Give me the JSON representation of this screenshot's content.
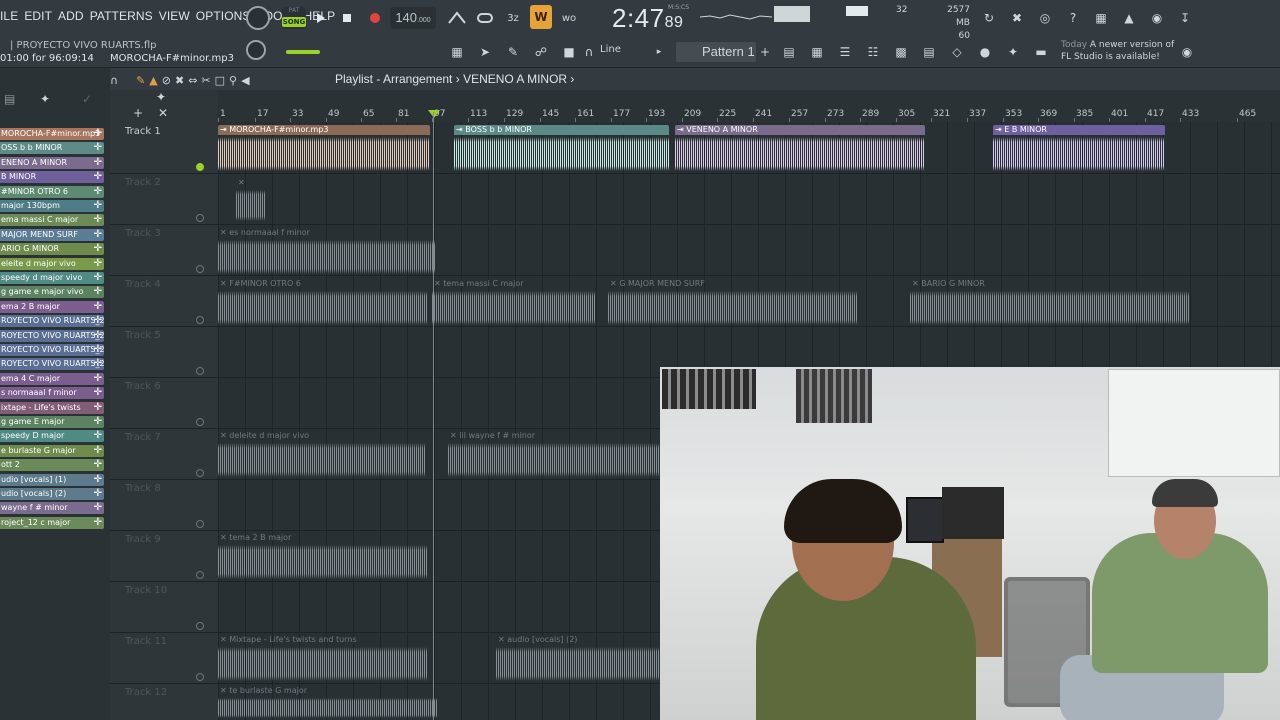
{
  "menu": [
    "ILE",
    "EDIT",
    "ADD",
    "PATTERNS",
    "VIEW",
    "OPTIONS",
    "TOOLS",
    "HELP"
  ],
  "project": {
    "name": "| PROYECTO VIVO RUARTS.flp",
    "time_info": "01:00 for 96:09:14",
    "current_file": "MOROCHA-F#minor.mp3"
  },
  "transport": {
    "mode_pat": "PAT",
    "mode_song": "SONG",
    "tempo": "140",
    "tempo_decimals": ".000",
    "clock": "2:47",
    "clock_sub": "89",
    "clock_label": "M:S:CS",
    "cpu_value": "32",
    "memory": "2577 MB",
    "polyphony": "60",
    "play_icon": "play-icon",
    "stop_icon": "stop-icon",
    "record_icon": "record-icon"
  },
  "toolbar2": {
    "snap": "Line",
    "pattern": "Pattern 1"
  },
  "news": {
    "line1_prefix": "Today",
    "line1": "A newer version of",
    "line2": "FL Studio is available!"
  },
  "playlist": {
    "title": "Playlist - Arrangement",
    "arrangement": "VENENO A MINOR",
    "ruler_marks": [
      "1",
      "17",
      "33",
      "49",
      "65",
      "81",
      "97",
      "113",
      "129",
      "145",
      "161",
      "177",
      "193",
      "209",
      "225",
      "241",
      "257",
      "273",
      "289",
      "305",
      "321",
      "337",
      "353",
      "369",
      "385",
      "401",
      "417",
      "433",
      "465"
    ],
    "tracks": [
      "Track 1",
      "Track 2",
      "Track 3",
      "Track 4",
      "Track 5",
      "Track 6",
      "Track 7",
      "Track 8",
      "Track 9",
      "Track 10",
      "Track 11",
      "Track 12"
    ]
  },
  "browser_items": [
    {
      "label": "MOROCHA-F#minor.mp3",
      "color": "#a7755f"
    },
    {
      "label": "OSS b b MINOR",
      "color": "#5e8b86"
    },
    {
      "label": "ENENO A MINOR",
      "color": "#7b6b8e"
    },
    {
      "label": "B MINOR",
      "color": "#6f5f9a"
    },
    {
      "label": "#MINOR OTRO 6",
      "color": "#5d8a71"
    },
    {
      "label": "major 130bpm",
      "color": "#4f7d87"
    },
    {
      "label": "ema massi C major",
      "color": "#6c8a58"
    },
    {
      "label": "MAJOR MEND SURF",
      "color": "#5b7c95"
    },
    {
      "label": "ARIO G MINOR",
      "color": "#6f8a4d"
    },
    {
      "label": "eleite d major vivo",
      "color": "#7a9a4b"
    },
    {
      "label": "speedy d major vivo",
      "color": "#4f8a84"
    },
    {
      "label": "g game e major vivo",
      "color": "#5b8360"
    },
    {
      "label": "ema 2 B major",
      "color": "#7b5e8e"
    },
    {
      "label": "ROYECTO VIVO RUARTS_20",
      "color": "#5a6e94"
    },
    {
      "label": "ROYECTO VIVO RUARTS_20",
      "color": "#5a6e94"
    },
    {
      "label": "ROYECTO VIVO RUARTS_20",
      "color": "#5a6e94"
    },
    {
      "label": "ROYECTO VIVO RUARTS_20",
      "color": "#5a6e94"
    },
    {
      "label": "ema 4 C major",
      "color": "#7b5e8e"
    },
    {
      "label": "s normaaal f minor",
      "color": "#7b5e8e"
    },
    {
      "label": "ixtape - Life's twists",
      "color": "#835d75"
    },
    {
      "label": "g game E major",
      "color": "#5b8360"
    },
    {
      "label": "speedy D major",
      "color": "#4f8a84"
    },
    {
      "label": "e burlaste G major",
      "color": "#6f8a4d"
    },
    {
      "label": "ott 2",
      "color": "#6a8a5a"
    },
    {
      "label": "udio [vocals] (1)",
      "color": "#5d7b8c"
    },
    {
      "label": "udio [vocals] (2)",
      "color": "#5d7b8c"
    },
    {
      "label": "wayne f # minor",
      "color": "#7b6b8e"
    },
    {
      "label": "roject_12 c major",
      "color": "#6a8a5a"
    }
  ],
  "clips": [
    {
      "label": "MOROCHA-F#minor.mp3",
      "style": "color",
      "cap": "#8c6a58",
      "wave": "#e5ccb8"
    },
    {
      "label": "BOSS b b MINOR",
      "style": "color",
      "cap": "#5b8a86",
      "wave": "#c7e9e4"
    },
    {
      "label": "VENENO A MINOR",
      "style": "color",
      "cap": "#7a6a8c",
      "wave": "#d9cbe9"
    },
    {
      "label": "E B MINOR",
      "style": "color",
      "cap": "#6e60a0",
      "wave": "#d3c9f0"
    },
    {
      "label": "",
      "style": "grey"
    },
    {
      "label": "es normaaal f minor",
      "style": "grey"
    },
    {
      "label": "F#MINOR OTRO 6",
      "style": "grey"
    },
    {
      "label": "tema massi C major",
      "style": "grey"
    },
    {
      "label": "G MAJOR MEND SURF",
      "style": "grey"
    },
    {
      "label": "BARIO G MINOR",
      "style": "grey"
    },
    {
      "label": "deleite d major vivo",
      "style": "grey"
    },
    {
      "label": "lil wayne f # minor",
      "style": "grey"
    },
    {
      "label": "tema 2 B major",
      "style": "grey"
    },
    {
      "label": "Mixtape - Life's twists and turns",
      "style": "grey"
    },
    {
      "label": "audio [vocals] (2)",
      "style": "grey"
    },
    {
      "label": "te burlaste G major",
      "style": "grey"
    }
  ]
}
